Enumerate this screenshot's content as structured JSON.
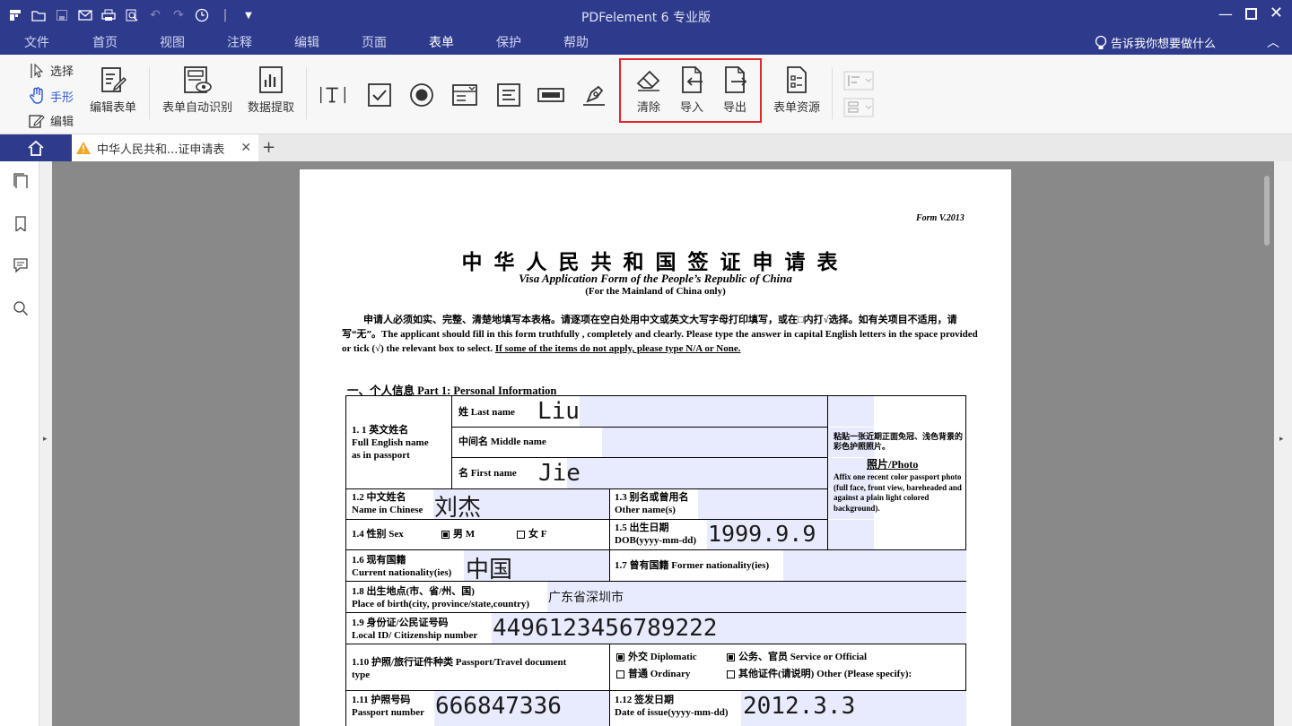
{
  "titlebar": {
    "title": "PDFelement  6 专业版"
  },
  "menu": [
    "文件",
    "首页",
    "视图",
    "注释",
    "编辑",
    "页面",
    "表单",
    "保护",
    "帮助"
  ],
  "active_menu": "表单",
  "hint": "告诉我你想要做什么",
  "ribbon": {
    "modes": {
      "select": "选择",
      "hand": "手形",
      "edit": "编辑"
    },
    "edit_form": "编辑表单",
    "auto_recognize": "表单自动识别",
    "data_extract": "数据提取",
    "clear": "清除",
    "import": "导入",
    "export": "导出",
    "form_resources": "表单资源"
  },
  "tab": {
    "doc_name": "中华人民共和...证申请表"
  },
  "document": {
    "form_version": "Form V.2013",
    "title_cn": "中华人民共和国签证申请表",
    "title_en": "Visa Application Form of the People’s Republic of China",
    "subtitle": "(For the Mainland of China only)",
    "intro_cn": "申请人必须如实、完整、清楚地填写本表格。请逐项在空白处用中文或英文大写字母打印填写，或在□内打√选择。如有关项目不适用，请写“无”。",
    "intro_en": "The applicant should fill in this form truthfully ,  completely and clearly. Please type the answer in capital English letters in the space provided or tick (√) the relevant box to select.",
    "intro_ul": "If some of the items do not apply, please type N/A or None.",
    "part1": "一、个人信息 Part 1: Personal Information",
    "labels": {
      "f11a": "1. 1 英文姓名",
      "f11b": "Full English name",
      "f11c": "as in passport",
      "last": "姓 Last name",
      "middle": "中间名 Middle name",
      "first": "名 First name",
      "photo_cn": "粘贴一张近期正面免冠、浅色背景的彩色护照照片。",
      "photo_title": "照片/Photo",
      "photo_en": "Affix one recent color passport photo (full face, front view, bareheaded and against a plain light colored background).",
      "f12a": "1.2 中文姓名",
      "f12b": "Name in Chinese",
      "f13a": "1.3 别名或曾用名",
      "f13b": "Other name(s)",
      "f14": "1.4 性别 Sex",
      "male": "男  M",
      "female": "女  F",
      "f15a": "1.5 出生日期",
      "f15b": "DOB(yyyy-mm-dd)",
      "f16a": "1.6 现有国籍",
      "f16b": "Current nationality(ies)",
      "f17": "1.7 曾有国籍 Former nationality(ies)",
      "f18a": "1.8 出生地点(市、省/州、国)",
      "f18b": "Place of birth(city, province/state,country)",
      "f19a": "1.9 身份证/公民证号码",
      "f19b": "Local ID/ Citizenship number",
      "f110a": "1.10  护照/旅行证件种类 Passport/Travel document",
      "f110b": "type",
      "diplomatic": "外交 Diplomatic",
      "service": "公务、官员 Service or Official",
      "ordinary": "普通 Ordinary",
      "other": "其他证件(请说明) Other (Please specify):",
      "f111a": "1.11 护照号码",
      "f111b": "Passport number",
      "f112a": "1.12 签发日期",
      "f112b": "Date of issue(yyyy-mm-dd)"
    },
    "values": {
      "last": "Liu",
      "first": "Jie",
      "chinese": "刘杰",
      "dob": "1999.9.9",
      "nationality": "中国",
      "birthplace": "广东省深圳市",
      "local_id": "4496123456789222",
      "passport": "666847336",
      "issue": "2012.3.3"
    }
  }
}
